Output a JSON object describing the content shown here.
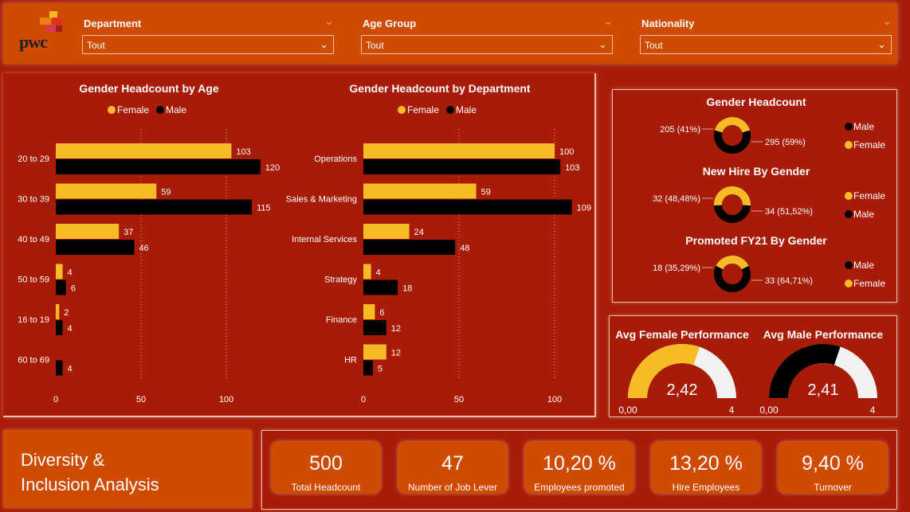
{
  "slicers": [
    {
      "title": "Department",
      "value": "Tout"
    },
    {
      "title": "Age Group",
      "value": "Tout"
    },
    {
      "title": "Nationality",
      "value": "Tout"
    }
  ],
  "logo_text": "pwc",
  "colors": {
    "female": "#f6bb25",
    "male": "#000000",
    "orange": "#d04b02",
    "background": "#a81c07"
  },
  "chart_data": [
    {
      "type": "bar",
      "title": "Gender Headcount by Age",
      "categories": [
        "20 to 29",
        "30 to 39",
        "40 to 49",
        "50 to 59",
        "16 to 19",
        "60 to 69"
      ],
      "series": [
        {
          "name": "Female",
          "values": [
            103,
            59,
            37,
            4,
            2,
            null
          ]
        },
        {
          "name": "Male",
          "values": [
            120,
            115,
            46,
            6,
            4,
            4
          ]
        }
      ],
      "xticks": [
        "0",
        "50",
        "100"
      ],
      "xlim": [
        0,
        130
      ],
      "legend": "top"
    },
    {
      "type": "bar",
      "title": "Gender Headcount by Department",
      "categories": [
        "Operations",
        "Sales & Marketing",
        "Internal Services",
        "Strategy",
        "Finance",
        "HR"
      ],
      "series": [
        {
          "name": "Female",
          "values": [
            100,
            59,
            24,
            4,
            6,
            12
          ]
        },
        {
          "name": "Male",
          "values": [
            103,
            109,
            48,
            18,
            12,
            5
          ]
        }
      ],
      "xticks": [
        "0",
        "50",
        "100"
      ],
      "xlim": [
        0,
        110
      ],
      "legend": "top"
    }
  ],
  "donuts": [
    {
      "title": "Gender Headcount",
      "left_label": "205 (41%)",
      "right_label": "295 (59%)",
      "legend": [
        "Male",
        "Female"
      ],
      "legend_colors": [
        "#000000",
        "#f6bb25"
      ],
      "female_fraction": 0.41
    },
    {
      "title": "New Hire By Gender",
      "left_label": "32 (48,48%)",
      "right_label": "34 (51,52%)",
      "legend": [
        "Female",
        "Male"
      ],
      "legend_colors": [
        "#f6bb25",
        "#000000"
      ],
      "female_fraction": 0.5152
    },
    {
      "title": "Promoted FY21 By Gender",
      "left_label": "18 (35,29%)",
      "right_label": "33 (64,71%)",
      "legend": [
        "Male",
        "Female"
      ],
      "legend_colors": [
        "#000000",
        "#f6bb25"
      ],
      "female_fraction": 0.3529
    }
  ],
  "gauges": [
    {
      "title": "Avg Female Performance",
      "value": "2,42",
      "min": "0,00",
      "max": "4",
      "fraction": 0.605,
      "color": "#f6bb25"
    },
    {
      "title": "Avg Male Performance",
      "value": "2,41",
      "min": "0,00",
      "max": "4",
      "fraction": 0.6025,
      "color": "#000000"
    }
  ],
  "report_title": [
    "Diversity &",
    "Inclusion Analysis"
  ],
  "kpis": [
    {
      "value": "500",
      "label": "Total Headcount"
    },
    {
      "value": "47",
      "label": "Number of Job Lever"
    },
    {
      "value": "10,20 %",
      "label": "Employees promoted"
    },
    {
      "value": "13,20 %",
      "label": "Hire Employees"
    },
    {
      "value": "9,40 %",
      "label": "Turnover"
    }
  ]
}
